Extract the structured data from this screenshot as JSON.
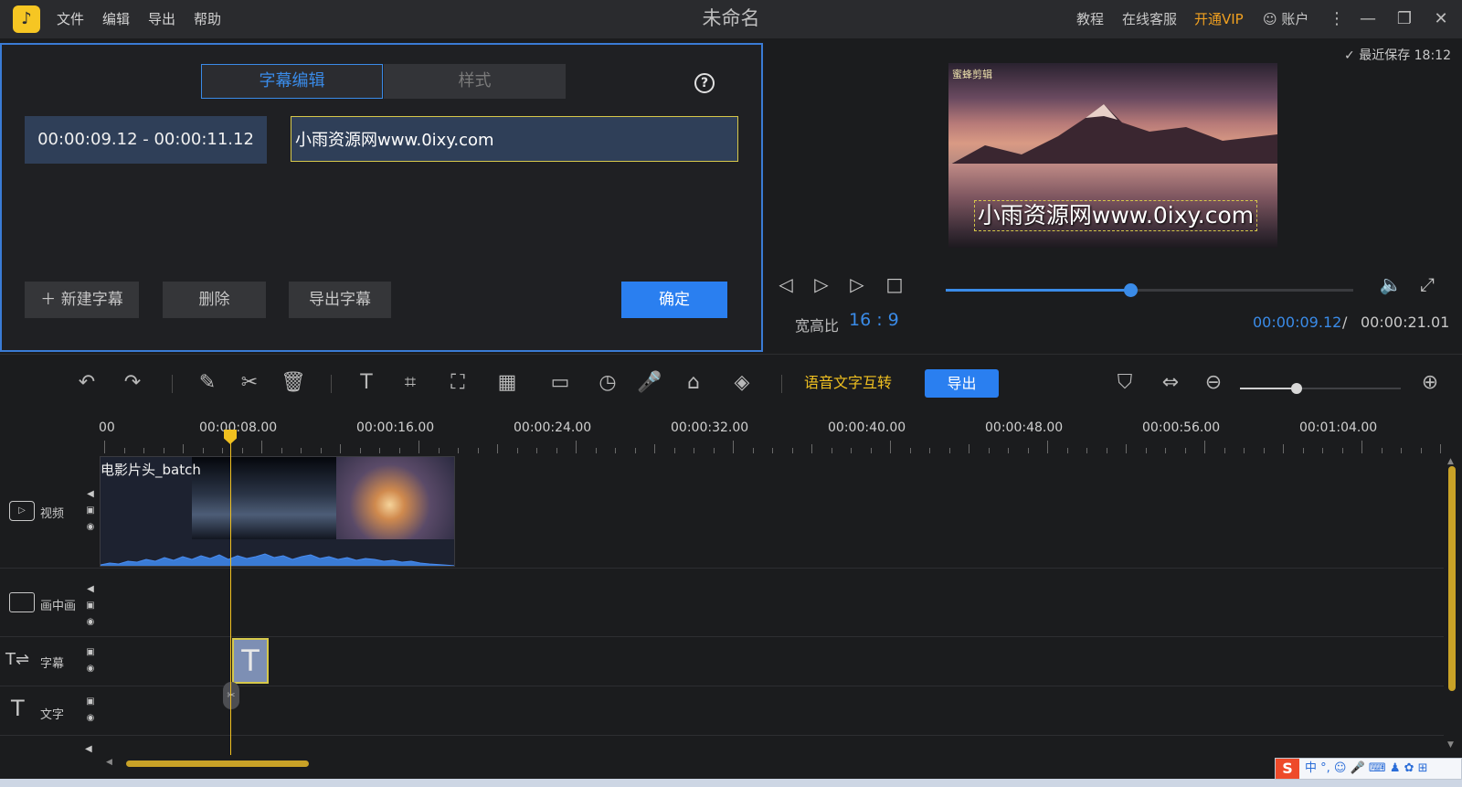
{
  "app": {
    "title": "未命名",
    "menu": [
      "文件",
      "编辑",
      "导出",
      "帮助"
    ],
    "right_links": {
      "tutorial": "教程",
      "support": "在线客服",
      "vip": "开通VIP",
      "account": "账户"
    }
  },
  "editor": {
    "tab_edit": "字幕编辑",
    "tab_style": "样式",
    "time_range": "00:00:09.12 - 00:00:11.12",
    "subtitle_text": "小雨资源网www.0ixy.com",
    "btn_new": "新建字幕",
    "btn_delete": "删除",
    "btn_export": "导出字幕",
    "btn_ok": "确定"
  },
  "preview": {
    "last_saved": "最近保存 18:12",
    "watermark": "蜜蜂剪辑",
    "subtitle_overlay": "小雨资源网www.0ixy.com",
    "aspect_label": "宽高比",
    "aspect_value": "16 : 9",
    "current_time": "00:00:09.12",
    "separator": "/",
    "total_time": "00:00:21.01",
    "progress_fraction": 0.454
  },
  "toolbar": {
    "speech_to_text": "语音文字互转",
    "export": "导出",
    "zoom_fraction": 0.35
  },
  "timeline": {
    "ruler_labels": [
      "00",
      "00:00:08.00",
      "00:00:16.00",
      "00:00:24.00",
      "00:00:32.00",
      "00:00:40.00",
      "00:00:48.00",
      "00:00:56.00",
      "00:01:04.00"
    ],
    "tracks": {
      "video": "视频",
      "pip": "画中画",
      "subtitle": "字幕",
      "text": "文字"
    },
    "clip_name": "电影片头_batch"
  },
  "ime": {
    "label": "中"
  }
}
